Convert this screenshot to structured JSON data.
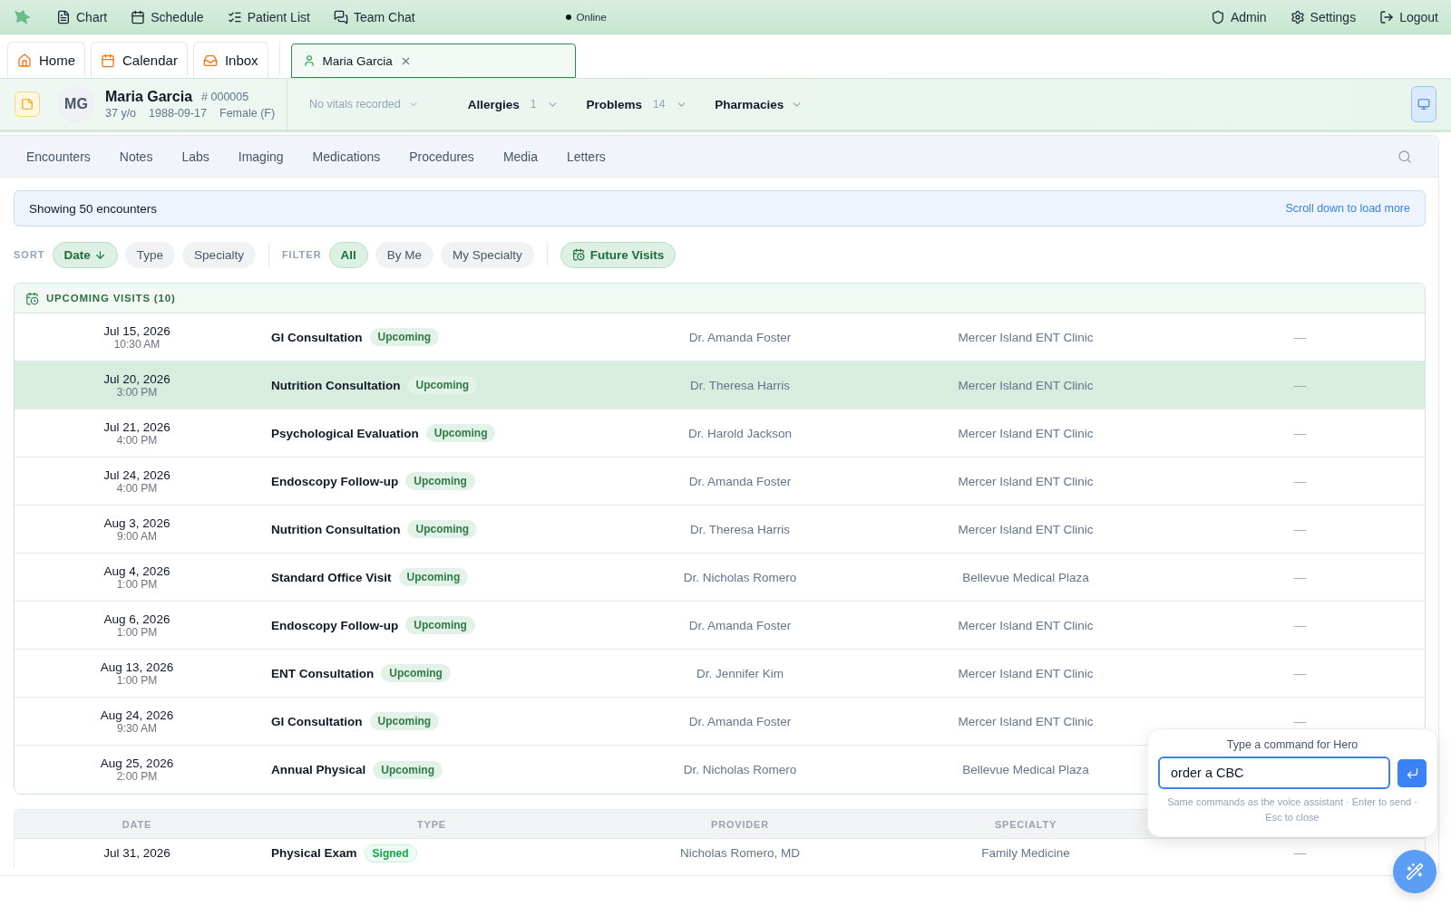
{
  "top_nav": {
    "items": [
      {
        "label": "Chart"
      },
      {
        "label": "Schedule"
      },
      {
        "label": "Patient List"
      },
      {
        "label": "Team Chat"
      }
    ],
    "status": "Online",
    "right_items": [
      {
        "label": "Admin"
      },
      {
        "label": "Settings"
      },
      {
        "label": "Logout"
      }
    ]
  },
  "tabs": [
    {
      "label": "Home",
      "selected": false
    },
    {
      "label": "Calendar",
      "selected": false
    },
    {
      "label": "Inbox",
      "selected": false
    }
  ],
  "patient_tab": {
    "label": "Maria Garcia",
    "selected": true
  },
  "patient": {
    "initials": "MG",
    "name": "Maria Garcia",
    "mrn_prefix": "#",
    "mrn": "000005",
    "age": "37 y/o",
    "dob": "1988-09-17",
    "sex": "Female (F)",
    "vitals": "No vitals recorded",
    "summary": [
      {
        "label": "Allergies",
        "count": "1"
      },
      {
        "label": "Problems",
        "count": "14"
      },
      {
        "label": "Pharmacies"
      }
    ]
  },
  "chart_tabs": [
    {
      "label": "Encounters"
    },
    {
      "label": "Notes"
    },
    {
      "label": "Labs"
    },
    {
      "label": "Imaging"
    },
    {
      "label": "Medications"
    },
    {
      "label": "Procedures"
    },
    {
      "label": "Media"
    },
    {
      "label": "Letters"
    }
  ],
  "banner": {
    "text": "Showing 50 encounters",
    "link": "Scroll down to load more"
  },
  "sort": {
    "label": "SORT",
    "options": [
      {
        "label": "Date",
        "selected": true
      },
      {
        "label": "Type",
        "selected": false
      },
      {
        "label": "Specialty",
        "selected": false
      }
    ]
  },
  "filter": {
    "label": "FILTER",
    "options": [
      {
        "label": "All",
        "selected": true
      },
      {
        "label": "By Me",
        "selected": false
      },
      {
        "label": "My Specialty",
        "selected": false
      }
    ],
    "future_visits": {
      "label": "Future Visits",
      "on": true
    }
  },
  "upcoming": {
    "title": "UPCOMING VISITS (10)",
    "rows": [
      {
        "date": "Jul 15, 2026",
        "time": "10:30 AM",
        "type": "GI Consultation",
        "badge": "Upcoming",
        "provider": "Dr. Amanda Foster",
        "location": "Mercer Island ENT Clinic",
        "column_5": "—",
        "selected": false
      },
      {
        "date": "Jul 20, 2026",
        "time": "3:00 PM",
        "type": "Nutrition Consultation",
        "badge": "Upcoming",
        "provider": "Dr. Theresa Harris",
        "location": "Mercer Island ENT Clinic",
        "column_5": "—",
        "selected": true
      },
      {
        "date": "Jul 21, 2026",
        "time": "4:00 PM",
        "type": "Psychological Evaluation",
        "badge": "Upcoming",
        "provider": "Dr. Harold Jackson",
        "location": "Mercer Island ENT Clinic",
        "column_5": "—",
        "selected": false
      },
      {
        "date": "Jul 24, 2026",
        "time": "4:00 PM",
        "type": "Endoscopy Follow-up",
        "badge": "Upcoming",
        "provider": "Dr. Amanda Foster",
        "location": "Mercer Island ENT Clinic",
        "column_5": "—",
        "selected": false
      },
      {
        "date": "Aug 3, 2026",
        "time": "9:00 AM",
        "type": "Nutrition Consultation",
        "badge": "Upcoming",
        "provider": "Dr. Theresa Harris",
        "location": "Mercer Island ENT Clinic",
        "column_5": "—",
        "selected": false
      },
      {
        "date": "Aug 4, 2026",
        "time": "1:00 PM",
        "type": "Standard Office Visit",
        "badge": "Upcoming",
        "provider": "Dr. Nicholas Romero",
        "location": "Bellevue Medical Plaza",
        "column_5": "—",
        "selected": false
      },
      {
        "date": "Aug 6, 2026",
        "time": "1:00 PM",
        "type": "Endoscopy Follow-up",
        "badge": "Upcoming",
        "provider": "Dr. Amanda Foster",
        "location": "Mercer Island ENT Clinic",
        "column_5": "—",
        "selected": false
      },
      {
        "date": "Aug 13, 2026",
        "time": "1:00 PM",
        "type": "ENT Consultation",
        "badge": "Upcoming",
        "provider": "Dr. Jennifer Kim",
        "location": "Mercer Island ENT Clinic",
        "column_5": "—",
        "selected": false
      },
      {
        "date": "Aug 24, 2026",
        "time": "9:30 AM",
        "type": "GI Consultation",
        "badge": "Upcoming",
        "provider": "Dr. Amanda Foster",
        "location": "Mercer Island ENT Clinic",
        "column_5": "—",
        "selected": false
      },
      {
        "date": "Aug 25, 2026",
        "time": "2:00 PM",
        "type": "Annual Physical",
        "badge": "Upcoming",
        "provider": "Dr. Nicholas Romero",
        "location": "Bellevue Medical Plaza",
        "selected": false
      }
    ]
  },
  "encounters": {
    "columns": [
      "DATE",
      "TYPE",
      "PROVIDER",
      "SPECIALTY"
    ],
    "rows": [
      {
        "date": "Jul 31, 2026",
        "type": "Physical Exam",
        "badge": "Signed",
        "provider": "Nicholas Romero, MD",
        "specialty": "Family Medicine",
        "column_5": "—"
      }
    ]
  },
  "command": {
    "title": "Type a command for Hero",
    "value": "order a CBC",
    "hint": "Same commands as the voice assistant · Enter to send · Esc to close"
  }
}
